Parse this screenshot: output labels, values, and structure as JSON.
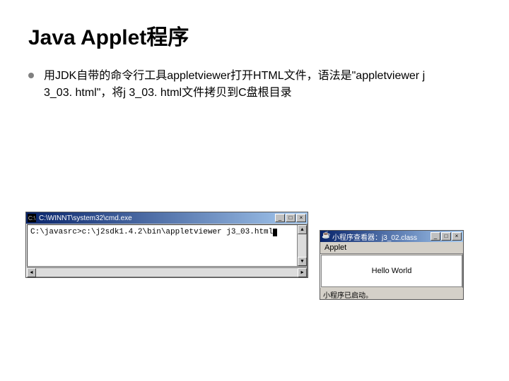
{
  "title": "Java Applet程序",
  "body": "用JDK自带的命令行工具appletviewer打开HTML文件，语法是\"appletviewer j 3_03. html\"，将j 3_03. html文件拷贝到C盘根目录",
  "console": {
    "title": "C:\\WINNT\\system32\\cmd.exe",
    "prompt": "C:\\javasrc>c:\\j2sdk1.4.2\\bin\\appletviewer j3_03.html",
    "min": "_",
    "max": "□",
    "close": "×",
    "up": "▲",
    "down": "▼",
    "left": "◄",
    "right": "►"
  },
  "applet": {
    "title": "小程序查看器：j3_02.class",
    "menu": "Applet",
    "content": "Hello World",
    "status": "小程序已启动。",
    "min": "_",
    "max": "□",
    "close": "×"
  }
}
